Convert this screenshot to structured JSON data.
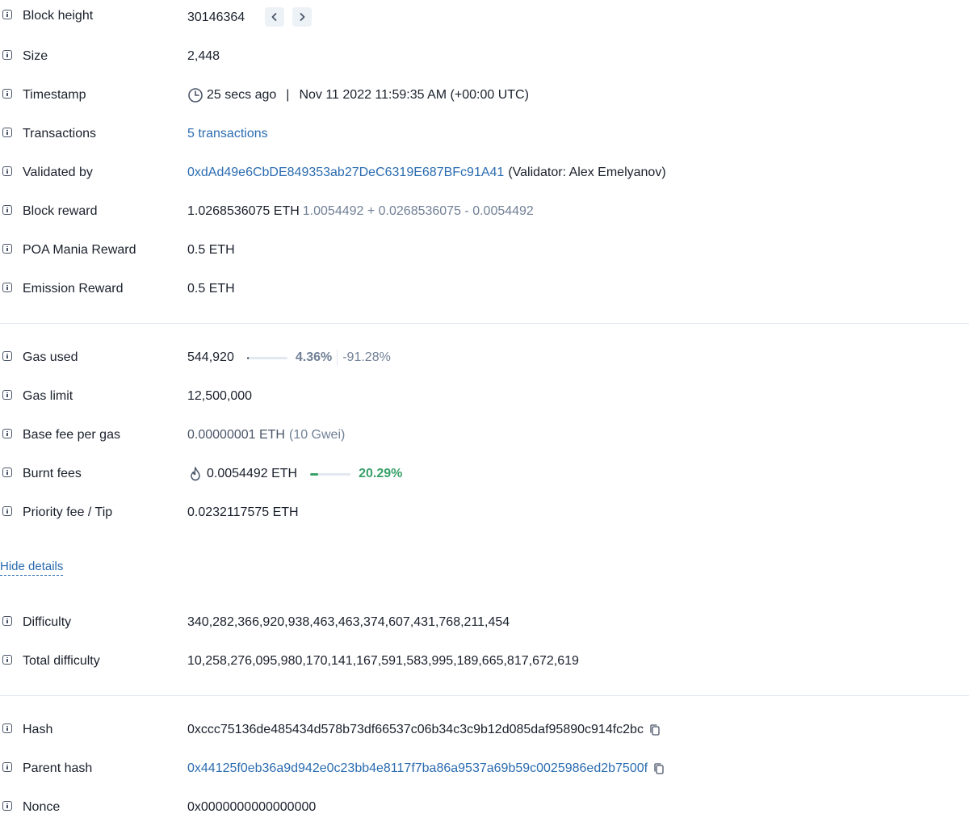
{
  "block_height": {
    "label": "Block height",
    "value": "30146364"
  },
  "size": {
    "label": "Size",
    "value": "2,448"
  },
  "timestamp": {
    "label": "Timestamp",
    "relative": "25 secs ago",
    "separator": "|",
    "absolute": "Nov 11 2022 11:59:35 AM (+00:00 UTC)"
  },
  "transactions": {
    "label": "Transactions",
    "value": "5 transactions"
  },
  "validated_by": {
    "label": "Validated by",
    "address": "0xdAd49e6CbDE849353ab27DeC6319E687BFc91A41",
    "note": "(Validator: Alex Emelyanov)"
  },
  "block_reward": {
    "label": "Block reward",
    "value": "1.0268536075 ETH",
    "breakdown": "1.0054492 + 0.0268536075 - 0.0054492"
  },
  "poa_mania_reward": {
    "label": "POA Mania Reward",
    "value": "0.5 ETH"
  },
  "emission_reward": {
    "label": "Emission Reward",
    "value": "0.5 ETH"
  },
  "gas_used": {
    "label": "Gas used",
    "value": "544,920",
    "percent": "4.36%",
    "percent_fraction": 0.0436,
    "delta": "-91.28%"
  },
  "gas_limit": {
    "label": "Gas limit",
    "value": "12,500,000"
  },
  "base_fee": {
    "label": "Base fee per gas",
    "value": "0.00000001 ETH",
    "gwei": "(10 Gwei)"
  },
  "burnt_fees": {
    "label": "Burnt fees",
    "value": "0.0054492 ETH",
    "percent": "20.29%",
    "percent_fraction": 0.2029
  },
  "priority_fee": {
    "label": "Priority fee / Tip",
    "value": "0.0232117575 ETH"
  },
  "hide_details": "Hide details",
  "difficulty": {
    "label": "Difficulty",
    "value": "340,282,366,920,938,463,463,374,607,431,768,211,454"
  },
  "total_difficulty": {
    "label": "Total difficulty",
    "value": "10,258,276,095,980,170,141,167,591,583,995,189,665,817,672,619"
  },
  "hash": {
    "label": "Hash",
    "value": "0xccc75136de485434d578b73df66537c06b34c3c9b12d085daf95890c914fc2bc"
  },
  "parent_hash": {
    "label": "Parent hash",
    "value": "0x44125f0eb36a9d942e0c23bb4e8117f7ba86a9537a69b59c0025986ed2b7500f"
  },
  "nonce": {
    "label": "Nonce",
    "value": "0x0000000000000000"
  },
  "colors": {
    "link": "#2b6cb0",
    "muted": "#718096",
    "success": "#38a169",
    "gas_bar": "#4a5568"
  },
  "icons": [
    "info-icon",
    "chevron-left-icon",
    "chevron-right-icon",
    "clock-icon",
    "flame-icon",
    "copy-icon"
  ]
}
